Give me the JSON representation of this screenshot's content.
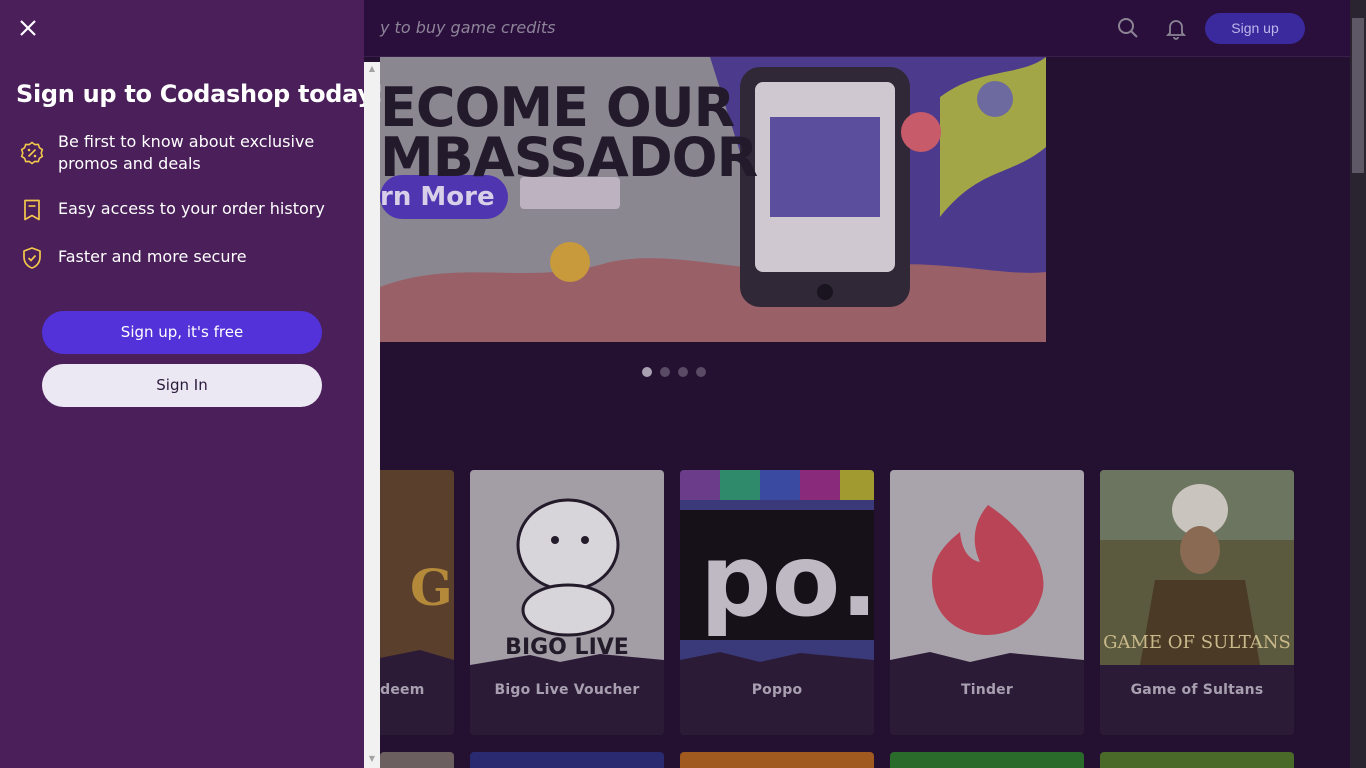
{
  "header": {
    "search_placeholder": "y to buy game credits",
    "signup_label": "Sign up",
    "icons": [
      "search-icon",
      "bell-icon"
    ]
  },
  "banner": {
    "headline_line1": "ECOME OUR",
    "headline_line2": "MBASSADOR",
    "cta": "rn More",
    "slides": 4,
    "active_slide": 1
  },
  "products": [
    {
      "name": "Redeem",
      "art_text": "G"
    },
    {
      "name": "Bigo Live Voucher",
      "art_text": "BIGO LIVE"
    },
    {
      "name": "Poppo",
      "art_text": "po."
    },
    {
      "name": "Tinder",
      "art_text": ""
    },
    {
      "name": "Game of Sultans",
      "art_text": "GAME OF SULTANS"
    }
  ],
  "drawer": {
    "title": "Sign up to Codashop today!",
    "benefits": [
      {
        "icon": "badge-percent-icon",
        "text": "Be first to know about exclusive promos and deals"
      },
      {
        "icon": "bookmark-receipt-icon",
        "text": "Easy access to your order history"
      },
      {
        "icon": "shield-check-icon",
        "text": "Faster and more secure"
      }
    ],
    "primary_button": "Sign up, it's free",
    "secondary_button": "Sign In"
  },
  "colors": {
    "drawer_bg": "#4a1f5a",
    "primary": "#5333d9",
    "accent_yellow": "#f3c84b",
    "page_bg": "#241030"
  }
}
